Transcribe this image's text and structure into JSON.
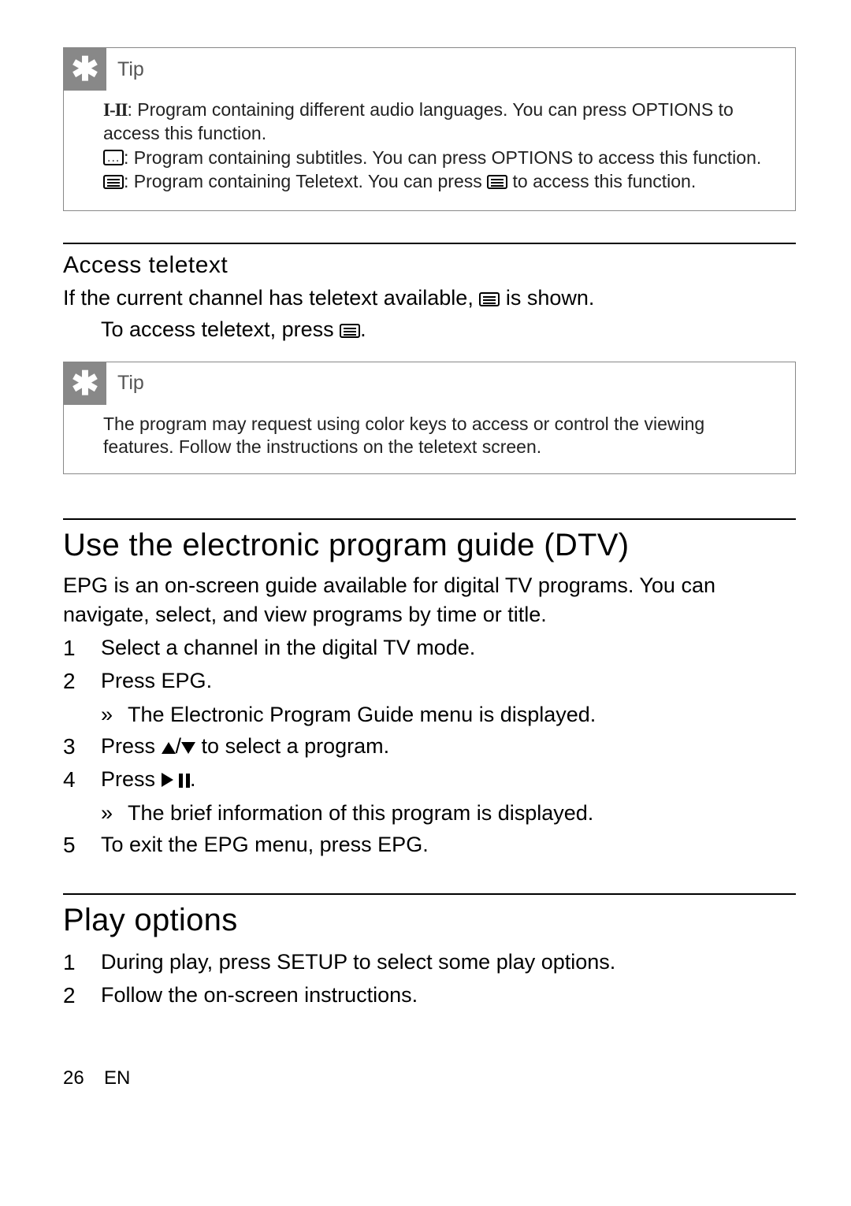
{
  "tip1": {
    "label": "Tip",
    "line1_pre": ": Program containing different audio languages. You can press ",
    "line1_opt": "OPTIONS",
    "line1_post": " to access this function.",
    "line2_pre": ": Program containing subtitles. You can press ",
    "line2_opt": "OPTIONS",
    "line2_post": " to access this function.",
    "line3_pre": ": Program containing Teletext. You can press ",
    "line3_key": "",
    "line3_post": " to access this function."
  },
  "section_teletext": {
    "heading": "Access teletext",
    "para_pre": "If the current channel has teletext available, ",
    "para_post": " is shown.",
    "indent_pre": "To access teletext, press ",
    "indent_post": "."
  },
  "tip2": {
    "label": "Tip",
    "body": "The program may request using color keys to access or control the viewing features. Follow the instructions on the teletext screen."
  },
  "section_epg": {
    "heading": "Use the electronic program guide (DTV)",
    "intro": "EPG is an on-screen guide available for digital TV programs. You can navigate, select, and view programs by time or title.",
    "items": [
      {
        "num": "1",
        "text": "Select a channel in the digital TV mode."
      },
      {
        "num": "2",
        "pre": "Press ",
        "key": "EPG",
        "post": ".",
        "sub": "The Electronic Program Guide menu is displayed."
      },
      {
        "num": "3",
        "pre": "Press ",
        "mid": "/",
        "post": " to select a program."
      },
      {
        "num": "4",
        "pre": "Press ",
        "post": ".",
        "sub": "The brief information of this program is displayed."
      },
      {
        "num": "5",
        "pre": "To exit the EPG menu, press ",
        "key": "EPG",
        "post": "."
      }
    ]
  },
  "section_play": {
    "heading": "Play options",
    "items": [
      {
        "num": "1",
        "pre": "During play, press ",
        "key": "SETUP",
        "post": " to select some play options."
      },
      {
        "num": "2",
        "text": "Follow the on-screen instructions."
      }
    ]
  },
  "footer": {
    "page": "26",
    "lang": "EN"
  }
}
